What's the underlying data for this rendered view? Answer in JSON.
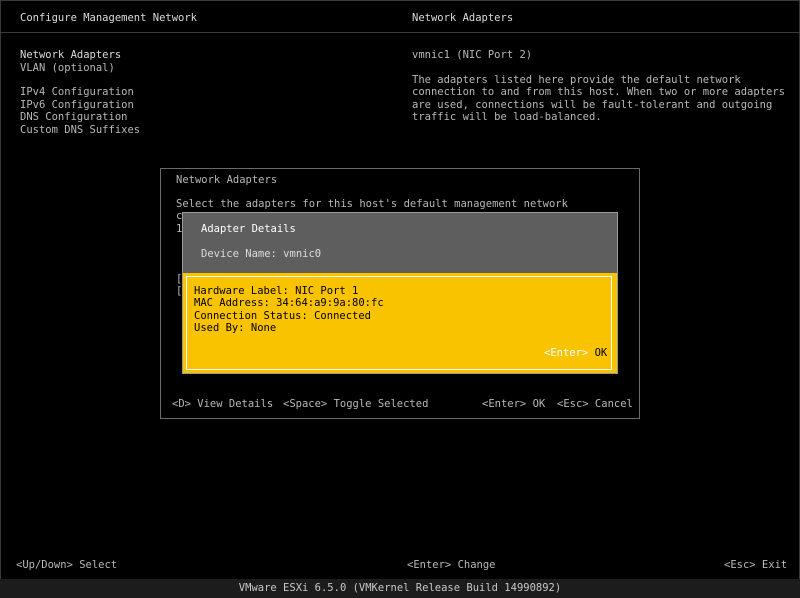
{
  "header": {
    "left_title": "Configure Management Network",
    "right_title": "Network Adapters"
  },
  "menu": {
    "items": [
      "Network Adapters",
      "VLAN (optional)",
      "IPv4 Configuration",
      "IPv6 Configuration",
      "DNS Configuration",
      "Custom DNS Suffixes"
    ]
  },
  "info": {
    "current_value": "vmnic1 (NIC Port 2)",
    "description_lines": [
      "The adapters listed here provide the default network",
      "connection to and from this host. When two or more adapters",
      "are used, connections will be fault-tolerant and outgoing",
      "traffic will be load-balanced."
    ]
  },
  "adapters_dialog": {
    "title": "Network Adapters",
    "prompt_line": "Select the adapters for this host's default management network",
    "partial_chars": [
      "c",
      "1",
      "[",
      "["
    ],
    "hints": {
      "view_details": "<D> View Details",
      "toggle": "<Space> Toggle Selected",
      "ok": "<Enter> OK",
      "cancel": "<Esc> Cancel"
    }
  },
  "details_modal": {
    "title": "Adapter Details",
    "device_name": "Device Name: vmnic0",
    "lines": [
      "Hardware Label: NIC Port 1",
      "MAC Address: 34:64:a9:9a:80:fc",
      "Connection Status: Connected",
      "Used By: None"
    ],
    "ok_key": "<Enter>",
    "ok_label": " OK"
  },
  "bottom_hints": {
    "select": "<Up/Down> Select",
    "change": "<Enter> Change",
    "exit": "<Esc> Exit"
  },
  "footer": {
    "build": "VMware ESXi 6.5.0 (VMKernel Release Build 14990892)"
  }
}
